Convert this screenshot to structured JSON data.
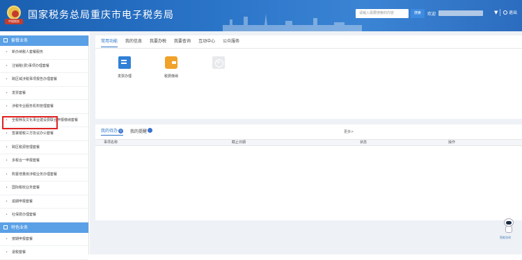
{
  "header": {
    "logo_text": "中国税务",
    "title": "国家税务总局重庆市电子税务局",
    "search_placeholder": "请输入需要搜索的内容",
    "search_button": "搜索",
    "welcome": "欢迎",
    "logout": "退出"
  },
  "sidebar": {
    "group1": "套餐业务",
    "items1": [
      "新办纳税人套餐服务",
      "注销税(费)事项办理套餐",
      "跨区域涉税事项报告办理套餐",
      "发票套餐",
      "涉税专业服务机构管理套餐",
      "全税种及文化事业建设费联合申报缴纳套餐",
      "签署银税三方协议办公套餐",
      "跨区税源管理套餐",
      "多税合一申报套餐",
      "购置增量房涉税业务办理套餐",
      "国际税收业务套餐",
      "逾期申报套餐",
      "社保费办理套餐"
    ],
    "group2": "特色业务",
    "items2": [
      "按期申报套餐",
      "退税套餐"
    ]
  },
  "top_panel": {
    "tabs": [
      "常用功能",
      "我的信息",
      "我要办税",
      "我要查询",
      "互动中心",
      "公众服务"
    ],
    "functions": [
      "发票办理",
      "税费缴纳"
    ]
  },
  "task_panel": {
    "tab_todo": "我的待办",
    "todo_count": "0",
    "tab_reminder": "我的提醒",
    "reminder_count": "",
    "more": "更多>",
    "columns": [
      "事项名称",
      "截止日期",
      "状态",
      "操作"
    ]
  },
  "assistant": {
    "label": "智能咨询"
  },
  "colors": {
    "header_blue": "#2a74c8",
    "sidebar_group": "#5aa0e6",
    "highlight_red": "#e02020"
  }
}
